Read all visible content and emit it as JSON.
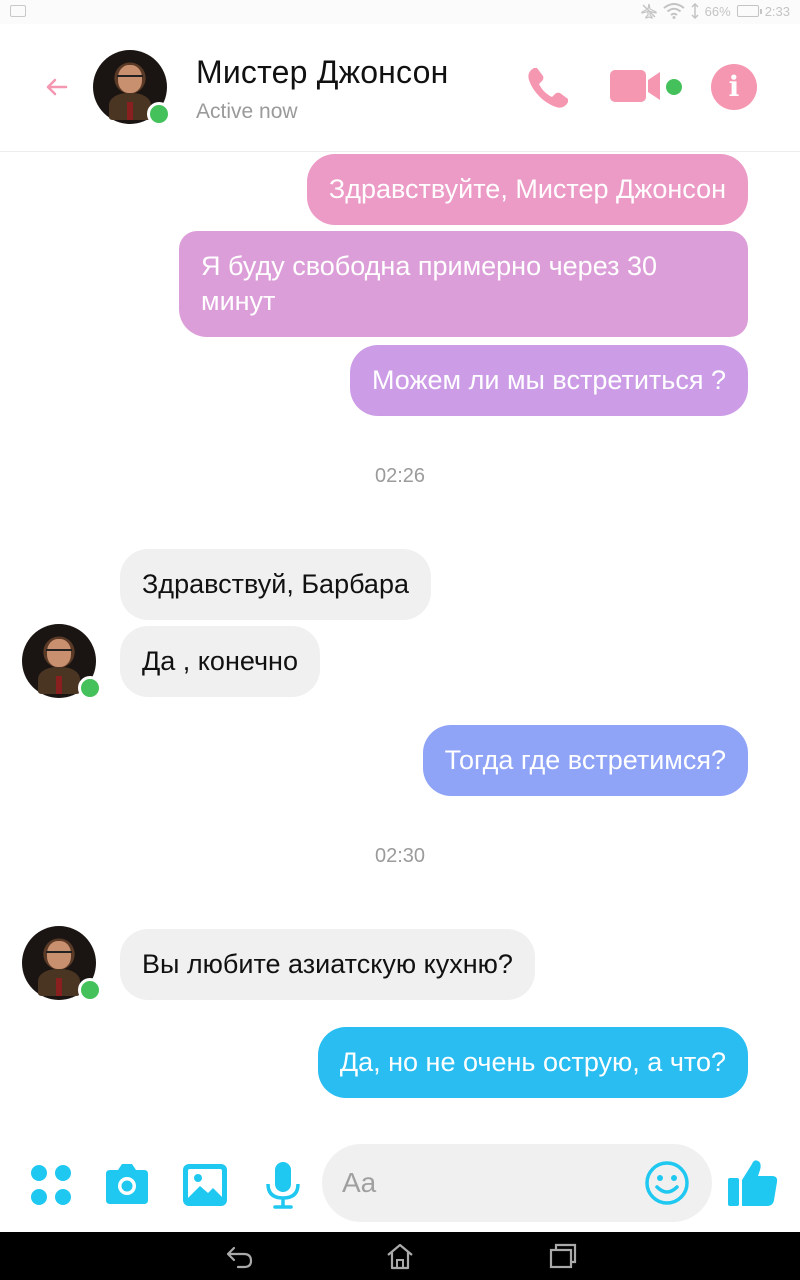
{
  "status_bar": {
    "battery": "66%",
    "time": "2:33"
  },
  "header": {
    "contact_name": "Мистер Джонсон",
    "status": "Active now",
    "accent": "#f597b1",
    "online_color": "#44c15b"
  },
  "messages": [
    {
      "type": "out",
      "text": "Здравствуйте, Мистер Джонсон"
    },
    {
      "type": "out",
      "text": "Я буду свободна примерно через 30 минут"
    },
    {
      "type": "out",
      "text": "Можем ли мы встретиться ?"
    },
    {
      "type": "time",
      "text": "02:26"
    },
    {
      "type": "in",
      "text": "Здравствуй, Барбара"
    },
    {
      "type": "in",
      "text": "Да , конечно"
    },
    {
      "type": "out",
      "text": "Тогда где встретимся?"
    },
    {
      "type": "time",
      "text": "02:30"
    },
    {
      "type": "in",
      "text": "Вы любите азиатскую кухню?"
    },
    {
      "type": "out",
      "text": "Да, но не очень острую, а что?"
    }
  ],
  "composer": {
    "placeholder": "Aa",
    "icons": [
      "apps-icon",
      "camera-icon",
      "gallery-icon",
      "microphone-icon",
      "emoji-icon",
      "thumbs-up-icon"
    ],
    "icon_color": "#1ec8f0"
  },
  "nav": {
    "icons": [
      "back-icon",
      "home-icon",
      "recent-apps-icon"
    ]
  }
}
